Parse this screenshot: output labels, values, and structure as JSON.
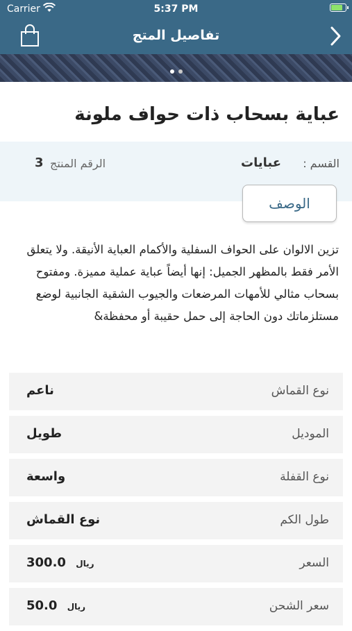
{
  "status_bar": {
    "carrier": "Carrier",
    "time": "5:37 PM"
  },
  "header": {
    "title": "تفاصيل المتج"
  },
  "product": {
    "title": "عباية بسحاب ذات حواف ملونة",
    "category_label": "القسم :",
    "category_value": "عبايات",
    "product_number_label": "الرقم المنتج",
    "product_number_value": "3"
  },
  "description": {
    "button_label": "الوصف",
    "text": "تزين الالوان على الحواف السفلية والأكمام العباية الأنيقة. ولا يتعلق الأمر فقط بالمظهر الجميل: إنها أيضاً عباية عملية مميزة. ومفتوح بسحاب مثالي للأمهات المرضعات والجيوب الشقية الجانبية لوضع مستلزماتك دون الحاجة إلى حمل حقيبة أو محفظة&"
  },
  "specs": [
    {
      "label": "نوع القماش",
      "value": "ناعم"
    },
    {
      "label": "الموديل",
      "value": "طويل"
    },
    {
      "label": "نوع القفلة",
      "value": "واسعة"
    },
    {
      "label": "طول الكم",
      "value": "نوع القماش"
    },
    {
      "label": "السعر",
      "value": "300.0",
      "currency": "ريال"
    },
    {
      "label": "سعر الشحن",
      "value": "50.0",
      "currency": "ريال"
    }
  ],
  "icons": {
    "cart": "shopping-bag-icon",
    "back": "chevron-right-icon",
    "wifi": "wifi-icon",
    "battery": "battery-icon"
  },
  "colors": {
    "primary": "#3a6987",
    "info_background": "#eef5f9",
    "row_background": "#f3f3f3"
  }
}
